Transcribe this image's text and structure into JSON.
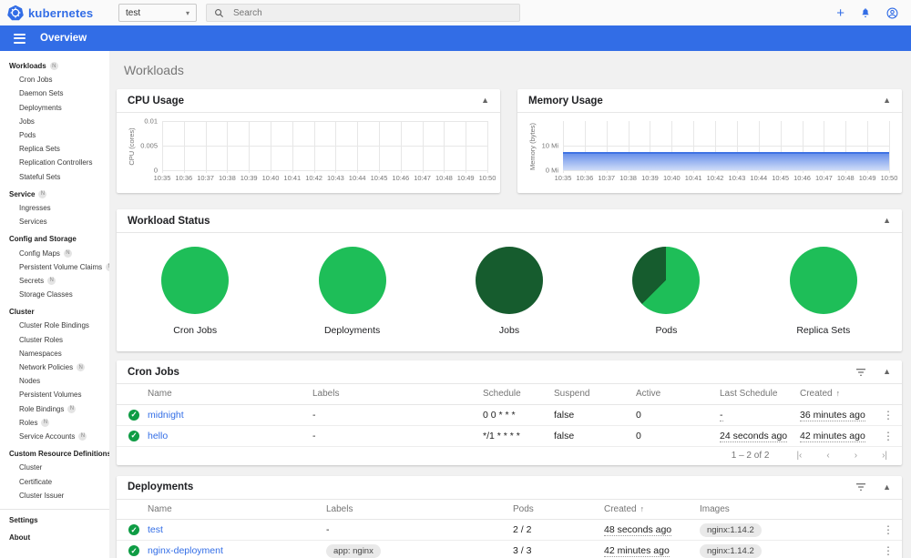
{
  "header": {
    "brand": "kubernetes",
    "namespace_value": "test",
    "search_placeholder": "Search"
  },
  "toolbar": {
    "title": "Overview"
  },
  "sidebar": {
    "items": [
      {
        "label": "Workloads",
        "header": true,
        "badge": "N"
      },
      {
        "label": "Cron Jobs"
      },
      {
        "label": "Daemon Sets"
      },
      {
        "label": "Deployments"
      },
      {
        "label": "Jobs"
      },
      {
        "label": "Pods"
      },
      {
        "label": "Replica Sets"
      },
      {
        "label": "Replication Controllers"
      },
      {
        "label": "Stateful Sets"
      },
      {
        "label": "Service",
        "header": true,
        "badge": "N"
      },
      {
        "label": "Ingresses"
      },
      {
        "label": "Services"
      },
      {
        "label": "Config and Storage",
        "header": true
      },
      {
        "label": "Config Maps",
        "badge": "N"
      },
      {
        "label": "Persistent Volume Claims",
        "badge": "N"
      },
      {
        "label": "Secrets",
        "badge": "N"
      },
      {
        "label": "Storage Classes"
      },
      {
        "label": "Cluster",
        "header": true
      },
      {
        "label": "Cluster Role Bindings"
      },
      {
        "label": "Cluster Roles"
      },
      {
        "label": "Namespaces"
      },
      {
        "label": "Network Policies",
        "badge": "N"
      },
      {
        "label": "Nodes"
      },
      {
        "label": "Persistent Volumes"
      },
      {
        "label": "Role Bindings",
        "badge": "N"
      },
      {
        "label": "Roles",
        "badge": "N"
      },
      {
        "label": "Service Accounts",
        "badge": "N"
      },
      {
        "label": "Custom Resource Definitions",
        "header": true
      },
      {
        "label": "Cluster"
      },
      {
        "label": "Certificate"
      },
      {
        "label": "Cluster Issuer"
      },
      {
        "label": "Settings",
        "header": true,
        "divider_before": true
      },
      {
        "label": "About",
        "header": true
      }
    ]
  },
  "page": {
    "title": "Workloads"
  },
  "charts": {
    "cpu": {
      "type": "line",
      "title": "CPU Usage",
      "ylabel": "CPU (cores)",
      "ylim": [
        0,
        0.01
      ],
      "y_ticks": [
        {
          "label": "0",
          "value": 0
        },
        {
          "label": "0.005",
          "value": 0.005
        },
        {
          "label": "0.01",
          "value": 0.01
        }
      ],
      "x_ticks": [
        "10:35",
        "10:36",
        "10:37",
        "10:38",
        "10:39",
        "10:40",
        "10:41",
        "10:42",
        "10:43",
        "10:44",
        "10:45",
        "10:46",
        "10:47",
        "10:48",
        "10:49",
        "10:50"
      ],
      "series": {
        "name": "CPU usage",
        "value": 0
      }
    },
    "memory": {
      "type": "area",
      "title": "Memory Usage",
      "ylabel": "Memory (bytes)",
      "ylim": [
        0,
        20
      ],
      "y_ticks": [
        {
          "label": "0 Mi",
          "value": 0
        },
        {
          "label": "10 Mi",
          "value": 10
        }
      ],
      "x_ticks": [
        "10:35",
        "10:36",
        "10:37",
        "10:38",
        "10:39",
        "10:40",
        "10:41",
        "10:42",
        "10:43",
        "10:44",
        "10:45",
        "10:46",
        "10:47",
        "10:48",
        "10:49",
        "10:50"
      ],
      "series": {
        "name": "Memory usage (Mi)",
        "value": 7.5
      }
    }
  },
  "workload_status": {
    "title": "Workload Status",
    "colors": {
      "running": "#1ebe58",
      "succeeded": "#165c2e"
    },
    "pies": [
      {
        "label": "Cron Jobs",
        "segments": [
          {
            "color": "#1ebe58",
            "frac": 1
          }
        ]
      },
      {
        "label": "Deployments",
        "segments": [
          {
            "color": "#1ebe58",
            "frac": 1
          }
        ]
      },
      {
        "label": "Jobs",
        "segments": [
          {
            "color": "#165c2e",
            "frac": 1
          }
        ]
      },
      {
        "label": "Pods",
        "segments": [
          {
            "color": "#1ebe58",
            "frac": 0.625
          },
          {
            "color": "#165c2e",
            "frac": 0.375
          }
        ]
      },
      {
        "label": "Replica Sets",
        "segments": [
          {
            "color": "#1ebe58",
            "frac": 1
          }
        ]
      }
    ]
  },
  "tables": {
    "cron_jobs": {
      "title": "Cron Jobs",
      "columns": [
        "Name",
        "Labels",
        "Schedule",
        "Suspend",
        "Active",
        "Last Schedule",
        "Created"
      ],
      "sort_column": "Created",
      "rows": [
        {
          "cells": [
            {
              "t": "midnight",
              "k": "link"
            },
            {
              "t": "-"
            },
            {
              "t": "0 0 * * *"
            },
            {
              "t": "false"
            },
            {
              "t": "0"
            },
            {
              "t": "-",
              "k": "time"
            },
            {
              "t": "36 minutes ago",
              "k": "time"
            }
          ]
        },
        {
          "cells": [
            {
              "t": "hello",
              "k": "link"
            },
            {
              "t": "-"
            },
            {
              "t": "*/1 * * * *"
            },
            {
              "t": "false"
            },
            {
              "t": "0"
            },
            {
              "t": "24 seconds ago",
              "k": "time"
            },
            {
              "t": "42 minutes ago",
              "k": "time"
            }
          ]
        }
      ],
      "footer": {
        "range": "1 – 2 of 2",
        "first": "|‹",
        "prev": "‹",
        "next": "›",
        "last": "›|"
      }
    },
    "deployments": {
      "title": "Deployments",
      "columns": [
        "Name",
        "Labels",
        "Pods",
        "Created",
        "Images"
      ],
      "sort_column": "Created",
      "rows": [
        {
          "cells": [
            {
              "t": "test",
              "k": "link"
            },
            {
              "t": "-"
            },
            {
              "t": "2 / 2"
            },
            {
              "t": "48 seconds ago",
              "k": "time"
            },
            {
              "t": "nginx:1.14.2",
              "k": "chip"
            }
          ]
        },
        {
          "cells": [
            {
              "t": "nginx-deployment",
              "k": "link"
            },
            {
              "t": "app: nginx",
              "k": "chip"
            },
            {
              "t": "3 / 3"
            },
            {
              "t": "42 minutes ago",
              "k": "time"
            },
            {
              "t": "nginx:1.14.2",
              "k": "chip"
            }
          ]
        }
      ]
    }
  }
}
